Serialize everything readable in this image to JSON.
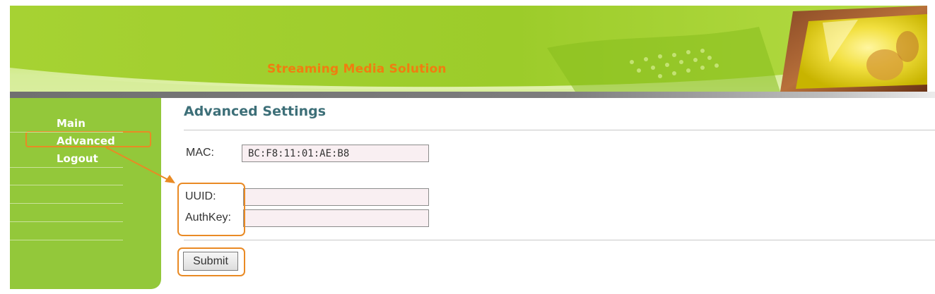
{
  "banner": {
    "title": "Streaming Media Solution",
    "colors": {
      "background": "#9cd02e",
      "title": "#f07d10"
    }
  },
  "sidebar": {
    "items": [
      {
        "label": "Main"
      },
      {
        "label": "Advanced"
      },
      {
        "label": "Logout"
      }
    ],
    "colors": {
      "background": "#93c83a",
      "text": "#ffffff",
      "highlight": "#e98a24"
    }
  },
  "main": {
    "title": "Advanced Settings",
    "mac": {
      "label": "MAC:",
      "value": "BC:F8:11:01:AE:B8"
    },
    "uuid": {
      "label": "UUID:",
      "value": ""
    },
    "authkey": {
      "label": "AuthKey:",
      "value": ""
    },
    "submit_label": "Submit",
    "colors": {
      "title": "#3d6f78",
      "input_background": "#f9eff2",
      "annotation": "#e98a24"
    }
  }
}
